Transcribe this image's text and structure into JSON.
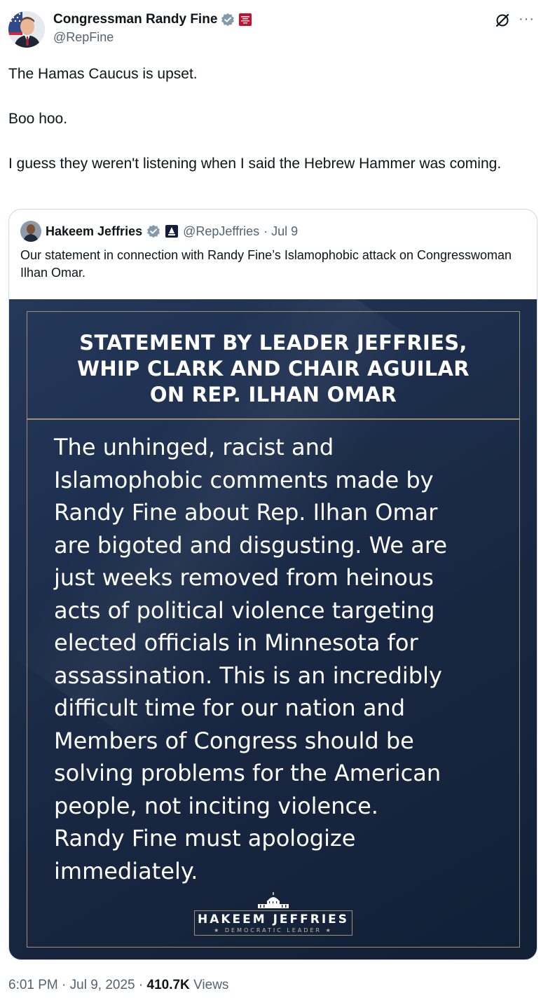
{
  "author": {
    "name": "Congressman Randy Fine",
    "handle": "@RepFine"
  },
  "tweet": {
    "lines": [
      "The Hamas Caucus is upset.",
      "Boo hoo.",
      "I guess they weren't listening when I said the Hebrew Hammer was coming."
    ]
  },
  "quote": {
    "author_name": "Hakeem Jeffries",
    "author_handle": "@RepJeffries",
    "date": "· Jul 9",
    "text": "Our statement in connection with Randy Fine’s Islamophobic attack on Congresswoman Ilhan Omar.",
    "image": {
      "title_lines": [
        "STATEMENT BY LEADER JEFFRIES,",
        "WHIP CLARK AND CHAIR AGUILAR",
        "ON REP. ILHAN OMAR"
      ],
      "body_lines": [
        "The unhinged, racist and",
        "Islamophobic comments made by",
        "Randy Fine about Rep. Ilhan Omar",
        "are bigoted and disgusting. We are",
        "just weeks removed from heinous",
        "acts of political violence targeting",
        "elected officials in Minnesota for",
        "assassination. This is an incredibly",
        "difficult time for our nation and",
        "Members of Congress should be",
        "solving problems for the American",
        "people, not inciting violence.",
        "Randy Fine must apologize",
        "immediately."
      ],
      "logo_name": "HAKEEM JEFFRIES",
      "logo_subtitle": "★ DEMOCRATIC LEADER ★"
    }
  },
  "footer": {
    "time": "6:01 PM",
    "date": "Jul 9, 2025",
    "views_count": "410.7K",
    "views_label": "Views"
  },
  "colors": {
    "text": "#0f1419",
    "secondary": "#536471",
    "verified": "#829aab",
    "image_bg": "#1b2c49",
    "gold": "#a08f72"
  }
}
